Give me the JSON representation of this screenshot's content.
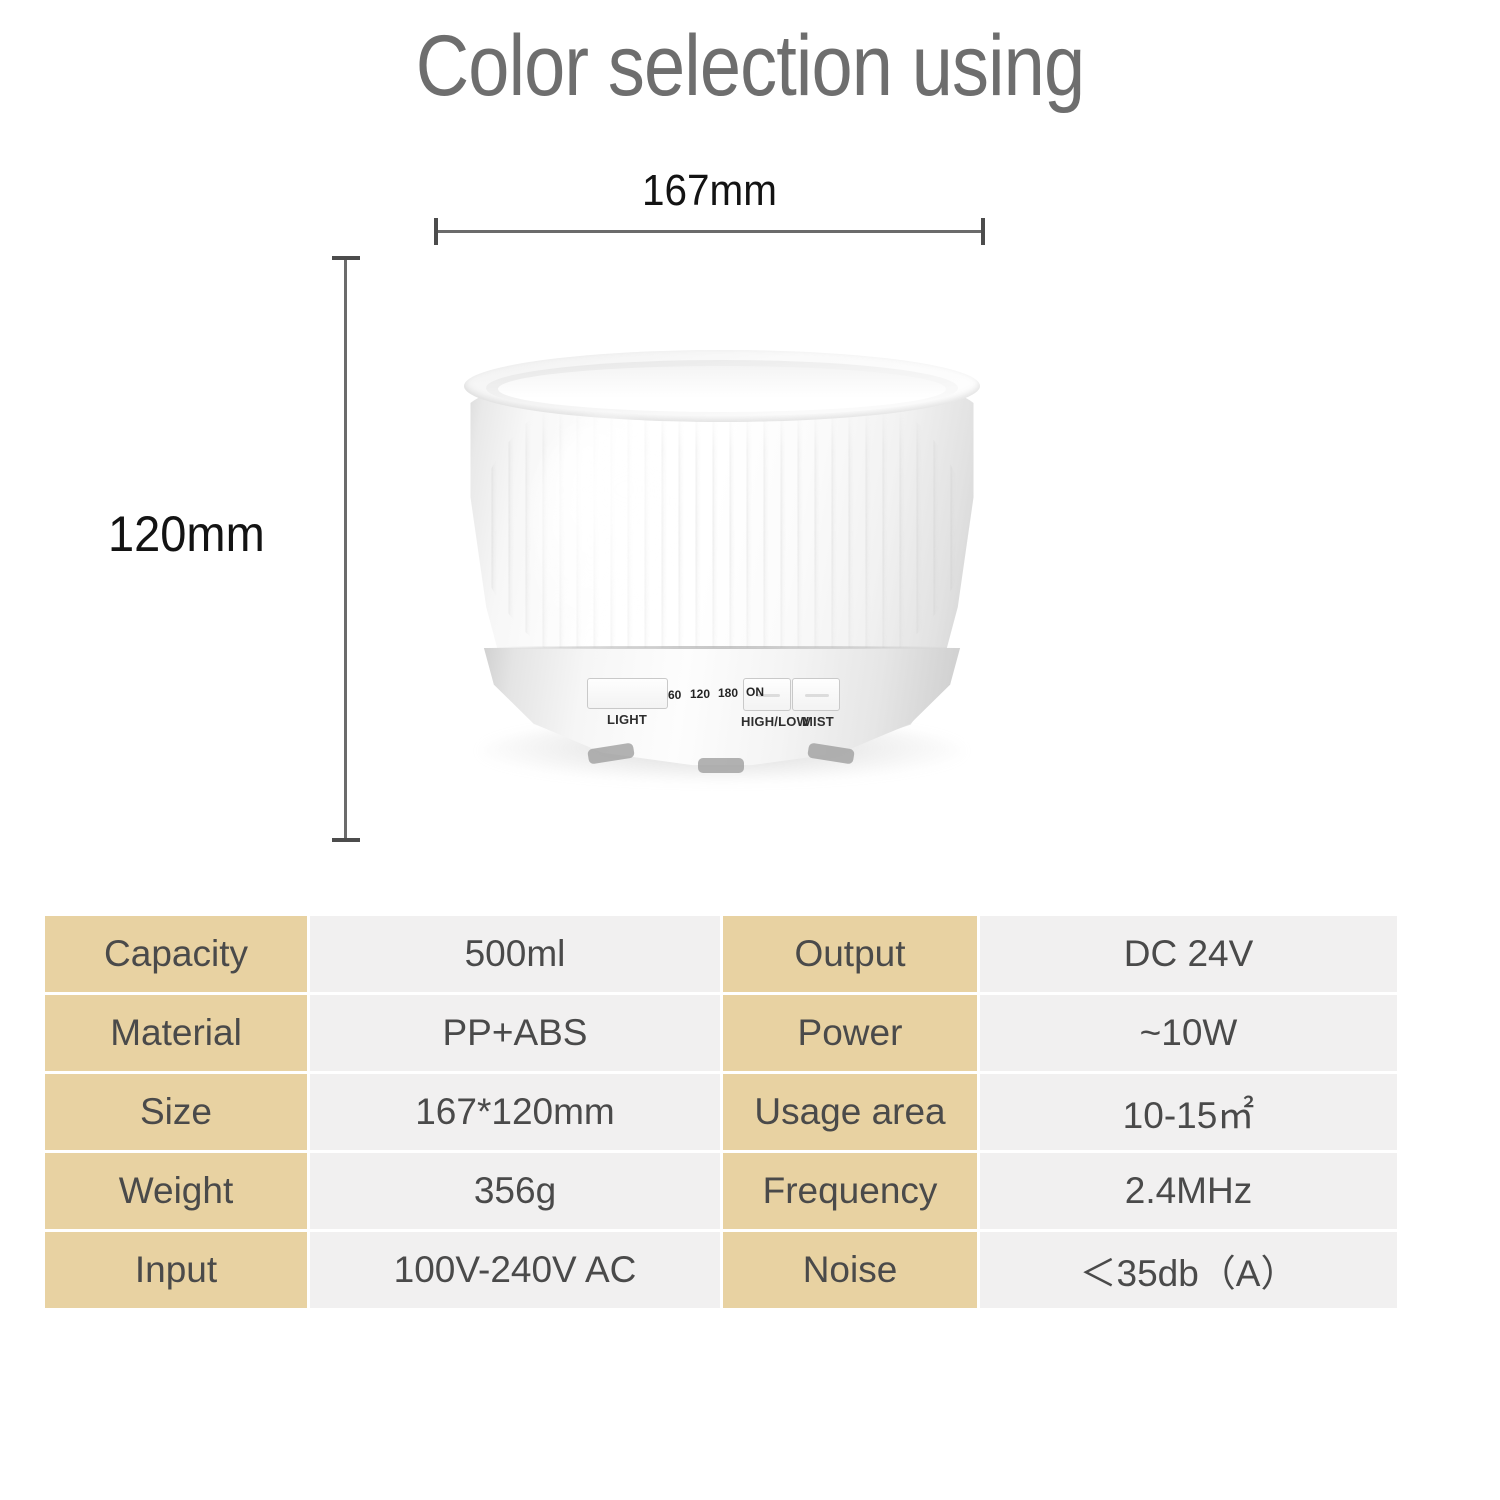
{
  "header": {
    "title": "Color selection using"
  },
  "diagram": {
    "width_label": "167mm",
    "height_label": "120mm",
    "product": {
      "name": "ultrasonic-aroma-diffuser",
      "controls": {
        "light_button": "LIGHT",
        "high_low_button": "HIGH/LOW",
        "mist_button": "MIST",
        "timer_marks": [
          "60",
          "120",
          "180",
          "ON"
        ]
      }
    }
  },
  "spec_table": {
    "rows": [
      {
        "label_left": "Capacity",
        "value_left": "500ml",
        "label_right": "Output",
        "value_right": "DC 24V"
      },
      {
        "label_left": "Material",
        "value_left": "PP+ABS",
        "label_right": "Power",
        "value_right": "~10W"
      },
      {
        "label_left": "Size",
        "value_left": "167*120mm",
        "label_right": "Usage area",
        "value_right": "10-15㎡"
      },
      {
        "label_left": "Weight",
        "value_left": "356g",
        "label_right": "Frequency",
        "value_right": "2.4MHz"
      },
      {
        "label_left": "Input",
        "value_left": "100V-240V AC",
        "label_right": "Noise",
        "value_right": "＜35db（A）"
      }
    ]
  },
  "colors": {
    "title_text": "#6e6e6e",
    "label_cell_bg": "#e8d2a2",
    "value_cell_bg": "#f1f0f0",
    "cell_text": "#4a4a4a",
    "dimension_line": "#6b6b6b",
    "page_bg": "#ffffff"
  }
}
